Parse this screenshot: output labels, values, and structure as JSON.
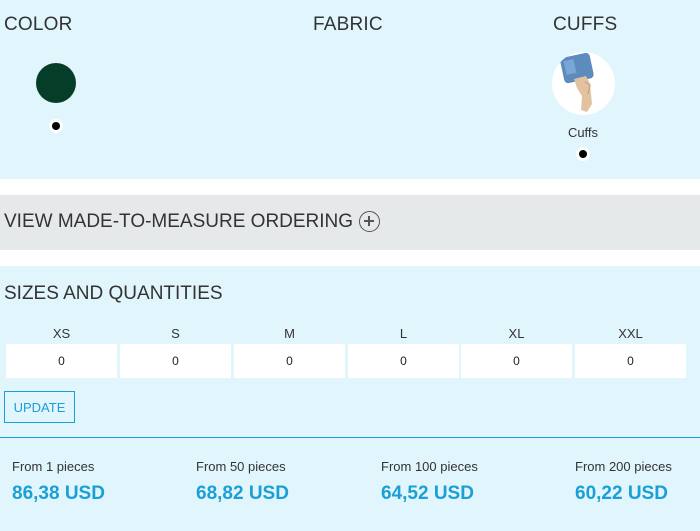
{
  "options": {
    "color_title": "COLOR",
    "fabric_title": "FABRIC",
    "cuffs_title": "CUFFS",
    "selected_color": "#063d28",
    "cuff_label": "Cuffs"
  },
  "made_to_measure": {
    "label": "VIEW MADE-TO-MEASURE ORDERING",
    "icon": "plus-circle-icon"
  },
  "sizes": {
    "title": "SIZES AND QUANTITIES",
    "headers": [
      "XS",
      "S",
      "M",
      "L",
      "XL",
      "XXL"
    ],
    "quantities": [
      "0",
      "0",
      "0",
      "0",
      "0",
      "0"
    ],
    "update_label": "UPDATE"
  },
  "pricing": [
    {
      "label": "From 1 pieces",
      "price": "86,38 USD"
    },
    {
      "label": "From 50 pieces",
      "price": "68,82 USD"
    },
    {
      "label": "From 100 pieces",
      "price": "64,52 USD"
    },
    {
      "label": "From 200 pieces",
      "price": "60,22 USD"
    }
  ],
  "accent_color": "#1a9fd6"
}
